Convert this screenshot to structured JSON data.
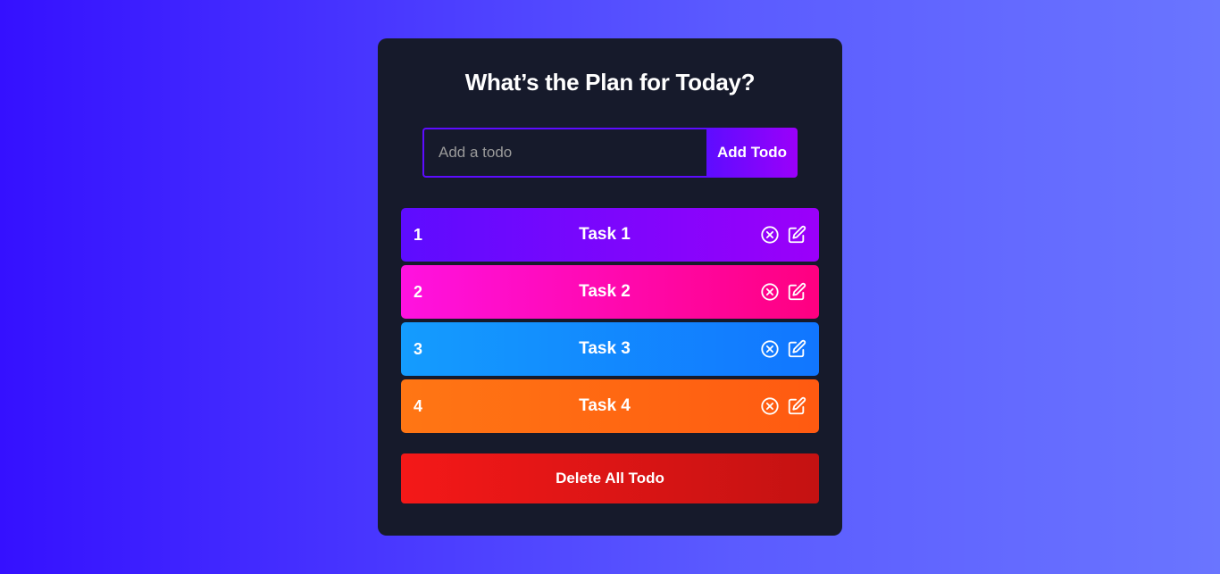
{
  "app": {
    "title": "What’s the Plan for Today?"
  },
  "form": {
    "input_placeholder": "Add a todo",
    "input_value": "",
    "add_label": "Add Todo"
  },
  "todos": [
    {
      "number": "1",
      "text": "Task 1",
      "color": "#5d0cff"
    },
    {
      "number": "2",
      "text": "Task 2",
      "color": "#ff12e0"
    },
    {
      "number": "3",
      "text": "Task 3",
      "color": "#149cfe"
    },
    {
      "number": "4",
      "text": "Task 4",
      "color": "#ff7614"
    }
  ],
  "row_icons": {
    "delete": "close-circle-icon",
    "edit": "edit-icon"
  },
  "footer": {
    "delete_all_label": "Delete All Todo"
  },
  "colors": {
    "background_start": "#3510ff",
    "background_end": "#6a75ff",
    "panel": "#161a2b",
    "accent": "#5d0cff",
    "danger": "#f41818"
  }
}
